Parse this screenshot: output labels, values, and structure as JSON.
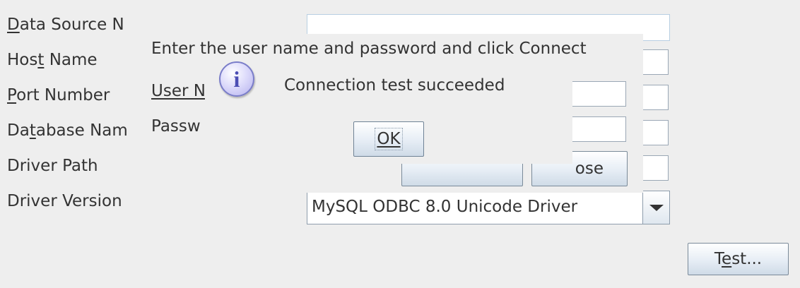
{
  "form": {
    "labels": {
      "data_source_name": "Data Source N",
      "host_name": "Host Name",
      "port_number": "Port Number",
      "database_name": "Database Nam",
      "driver_path": "Driver Path",
      "driver_version": "Driver Version"
    },
    "mnemonics": {
      "data_source_name": "D",
      "host_name": "t",
      "port_number": "P",
      "database_name": "t",
      "test_button": "e"
    },
    "driver_version_value": "MySQL ODBC 8.0 Unicode Driver",
    "test_button_label": "Test..."
  },
  "login_dialog": {
    "instruction": "Enter the user name and password and click Connect",
    "user_name_label": "User N",
    "password_label": "Passw",
    "close_button_label": "ose"
  },
  "message_dialog": {
    "message": "Connection test succeeded",
    "ok_button_label": "OK",
    "icon": "info-icon"
  }
}
